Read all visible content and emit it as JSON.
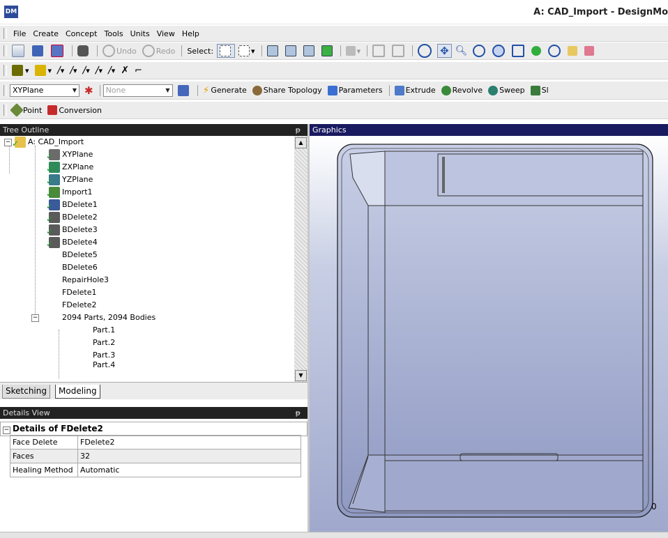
{
  "app": {
    "icon_label": "DM",
    "window_title": "A: CAD_Import - DesignMo"
  },
  "menu": [
    "File",
    "Create",
    "Concept",
    "Tools",
    "Units",
    "View",
    "Help"
  ],
  "toolbar1": {
    "undo_label": "Undo",
    "redo_label": "Redo",
    "select_label": "Select:"
  },
  "toolbar3": {
    "plane_select": "XYPlane",
    "sketch_select": "None",
    "generate_label": "Generate",
    "share_topology_label": "Share Topology",
    "parameters_label": "Parameters",
    "extrude_label": "Extrude",
    "revolve_label": "Revolve",
    "sweep_label": "Sweep",
    "skin_label_partial": "Sl"
  },
  "toolbar4": {
    "point_label": "Point",
    "conversion_label": "Conversion"
  },
  "tree": {
    "header": "Tree Outline",
    "pin_glyph": "ᵽ",
    "root": "A: CAD_Import",
    "items": [
      "XYPlane",
      "ZXPlane",
      "YZPlane",
      "Import1",
      "BDelete1",
      "BDelete2",
      "BDelete3",
      "BDelete4",
      "BDelete5",
      "BDelete6",
      "RepairHole3",
      "FDelete1",
      "FDelete2"
    ],
    "parts_group": "2094 Parts, 2094 Bodies",
    "parts": [
      "Part.1",
      "Part.2",
      "Part.3",
      "Part.4"
    ]
  },
  "tabs": [
    "Sketching",
    "Modeling"
  ],
  "details": {
    "header": "Details View",
    "title": "Details of FDelete2",
    "rows": [
      {
        "label": "Face Delete",
        "value": "FDelete2"
      },
      {
        "label": "Faces",
        "value": "32"
      },
      {
        "label": "Healing Method",
        "value": "Automatic"
      }
    ]
  },
  "graphics": {
    "header": "Graphics",
    "edge_label": "0"
  },
  "colors": {
    "graphics_header": "#191a60",
    "panel_header": "#222222",
    "check_green": "#24a12a",
    "model_fill": "#b4bcdb"
  }
}
